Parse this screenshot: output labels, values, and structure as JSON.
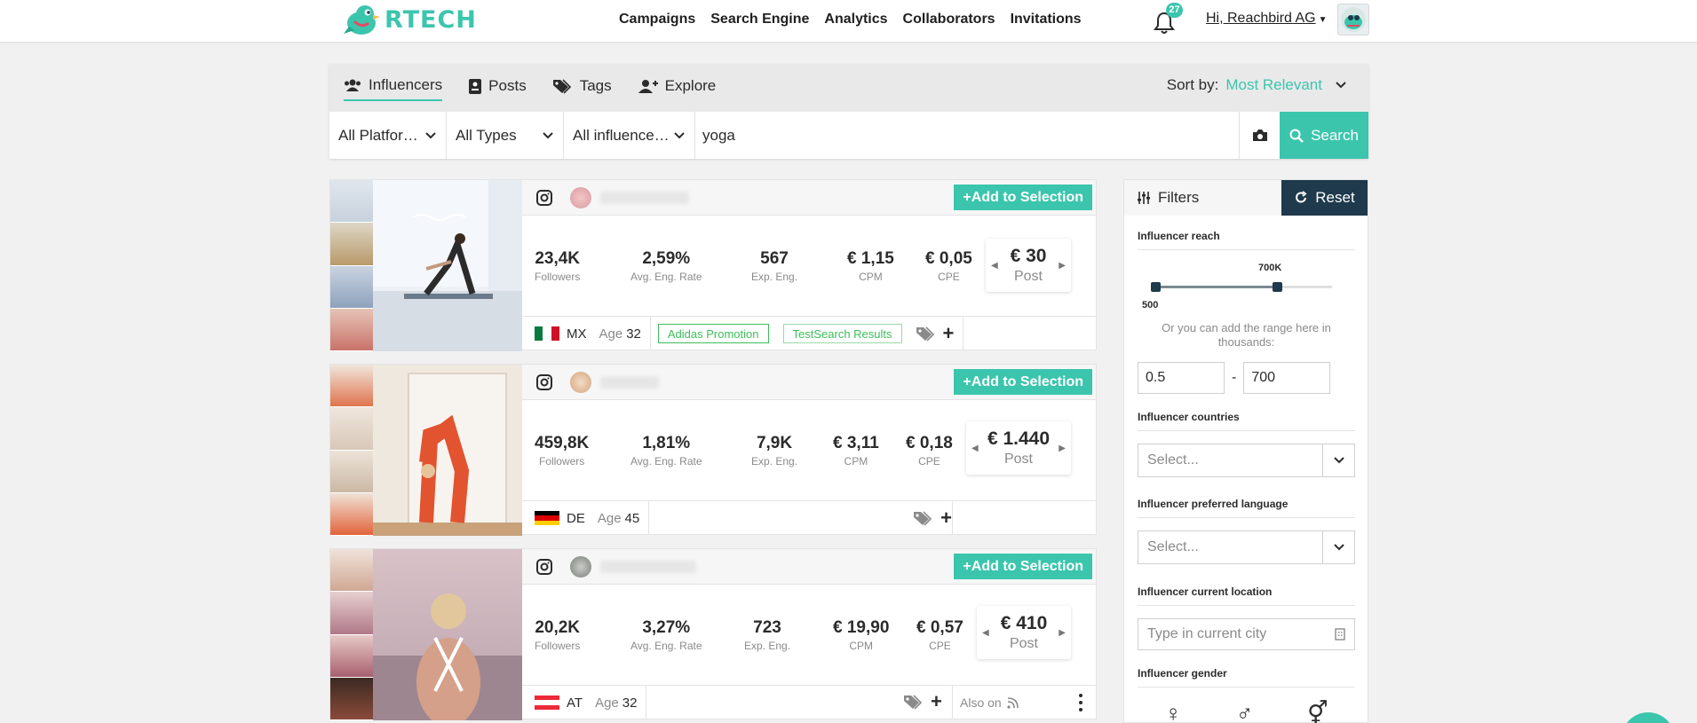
{
  "brand": {
    "name": "RTECH",
    "accent": "#3cc5ad",
    "dark": "#1e3a4c"
  },
  "nav": {
    "items": [
      "Campaigns",
      "Search Engine",
      "Analytics",
      "Collaborators",
      "Invitations"
    ]
  },
  "notifications": {
    "count": "27"
  },
  "user": {
    "greeting": "Hi, Reachbird AG"
  },
  "search": {
    "tabs": [
      "Influencers",
      "Posts",
      "Tags",
      "Explore"
    ],
    "sort_label": "Sort by:",
    "sort_value": "Most Relevant",
    "platform": "All Platfor…",
    "types": "All Types",
    "influencers": "All influence…",
    "query": "yoga",
    "button": "Search"
  },
  "card_common": {
    "add_label": "+Add to Selection",
    "followers_label": "Followers",
    "eng_rate_label": "Avg. Eng. Rate",
    "exp_eng_label": "Exp. Eng.",
    "cpm_label": "CPM",
    "cpe_label": "CPE",
    "price_type": "Post",
    "age_label": "Age",
    "also_on": "Also on"
  },
  "results": [
    {
      "followers": "23,4K",
      "eng_rate": "2,59%",
      "exp_eng": "567",
      "cpm": "€ 1,15",
      "cpe": "€ 0,05",
      "price": "€ 30",
      "country": "MX",
      "age": "32",
      "tags": [
        "Adidas Promotion",
        "TestSearch Results"
      ]
    },
    {
      "followers": "459,8K",
      "eng_rate": "1,81%",
      "exp_eng": "7,9K",
      "cpm": "€ 3,11",
      "cpe": "€ 0,18",
      "price": "€ 1.440",
      "country": "DE",
      "age": "45"
    },
    {
      "followers": "20,2K",
      "eng_rate": "3,27%",
      "exp_eng": "723",
      "cpm": "€ 19,90",
      "cpe": "€ 0,57",
      "price": "€ 410",
      "country": "AT",
      "age": "32"
    }
  ],
  "filters": {
    "title": "Filters",
    "reset": "Reset",
    "reach_title": "Influencer reach",
    "reach_min_label": "500",
    "reach_max_label": "700K",
    "range_note": "Or you can add the range here in thousands:",
    "range_min": "0.5",
    "range_max": "700",
    "range_dash": "-",
    "countries_title": "Influencer countries",
    "countries_placeholder": "Select...",
    "language_title": "Influencer preferred language",
    "language_placeholder": "Select...",
    "location_title": "Influencer current location",
    "location_placeholder": "Type in current city",
    "gender_title": "Influencer gender",
    "gender_icons": [
      "female-icon",
      "male-icon",
      "non-binary-icon"
    ]
  }
}
